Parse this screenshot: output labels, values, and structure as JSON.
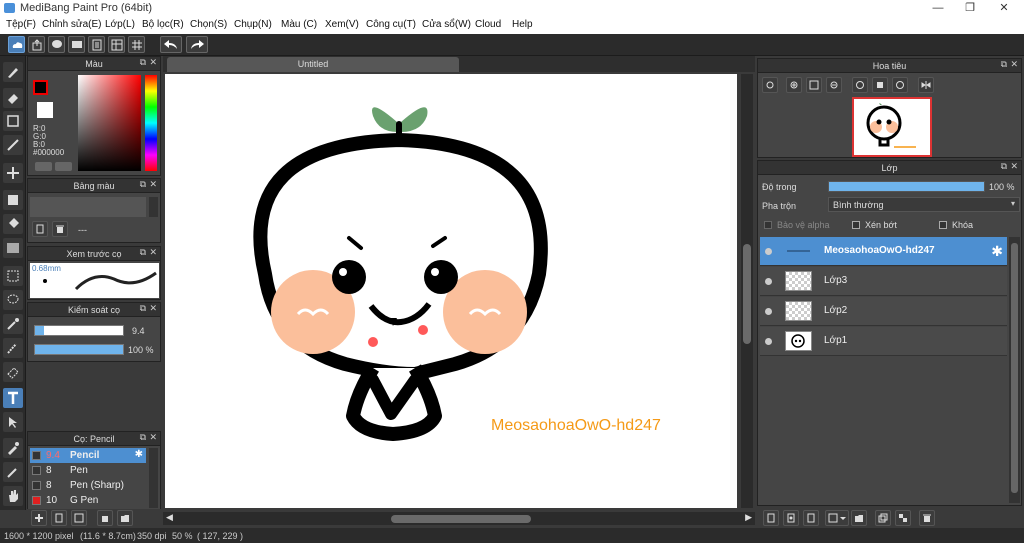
{
  "window": {
    "title": "MediBang Paint Pro (64bit)",
    "minimize": "—",
    "maximize": "❐",
    "close": "✕"
  },
  "menu": [
    "Tệp(F)",
    "Chỉnh sửa(E)",
    "Lớp(L)",
    "Bộ lọc(R)",
    "Chọn(S)",
    "Chụp(N)",
    "Màu (C)",
    "Xem(V)",
    "Công cụ(T)",
    "Cửa sổ(W)",
    "Cloud",
    "Help"
  ],
  "color_panel": {
    "title": "Màu",
    "r": "R:0",
    "g": "G:0",
    "b": "B:0",
    "hex": "#000000"
  },
  "palette_panel": {
    "title": "Bảng màu",
    "value": "---"
  },
  "preview_panel": {
    "title": "Xem trước cọ",
    "size": "0.68mm"
  },
  "brush_control_panel": {
    "title": "Kiểm soát cọ",
    "size_value": "9.4",
    "opacity_value": "100 %",
    "size_fraction": 0.1,
    "opacity_fraction": 1.0
  },
  "brush_panel": {
    "title": "Cọ: Pencil",
    "items": [
      {
        "size": "9.4",
        "name": "Pencil",
        "selected": true,
        "swatch": "#333333"
      },
      {
        "size": "8",
        "name": "Pen",
        "selected": false,
        "swatch": "#333333"
      },
      {
        "size": "8",
        "name": "Pen (Sharp)",
        "selected": false,
        "swatch": "#333333"
      },
      {
        "size": "10",
        "name": "G Pen",
        "selected": false,
        "swatch": "#e02020"
      }
    ]
  },
  "canvas": {
    "tab_label": "Untitled",
    "signature_text": "MeosaohoaOwO-hd247",
    "signature_color": "#f59a17"
  },
  "navigator_panel": {
    "title": "Hoa tiêu"
  },
  "layer_panel": {
    "title": "Lớp",
    "opacity_label": "Độ trong",
    "opacity_value": "100 %",
    "opacity_fraction": 1.0,
    "blend_label": "Pha trộn",
    "blend_value": "Bình thường",
    "protect_alpha": "Bảo vệ alpha",
    "clipping": "Xén bớt",
    "lock": "Khóa",
    "layers": [
      {
        "name": "MeosaohoaOwO-hd247",
        "selected": true
      },
      {
        "name": "Lớp3",
        "selected": false
      },
      {
        "name": "Lớp2",
        "selected": false
      },
      {
        "name": "Lớp1",
        "selected": false
      }
    ]
  },
  "status": {
    "size": "1600 * 1200 pixel",
    "dimensions": "(11.6 * 8.7cm)",
    "dpi": "350 dpi",
    "zoom": "50 %",
    "cursor": "( 127, 229 )"
  },
  "colors": {
    "accent": "#4d8fd1",
    "panel_bg": "#454545",
    "dark_bg": "#2b2b2b"
  }
}
